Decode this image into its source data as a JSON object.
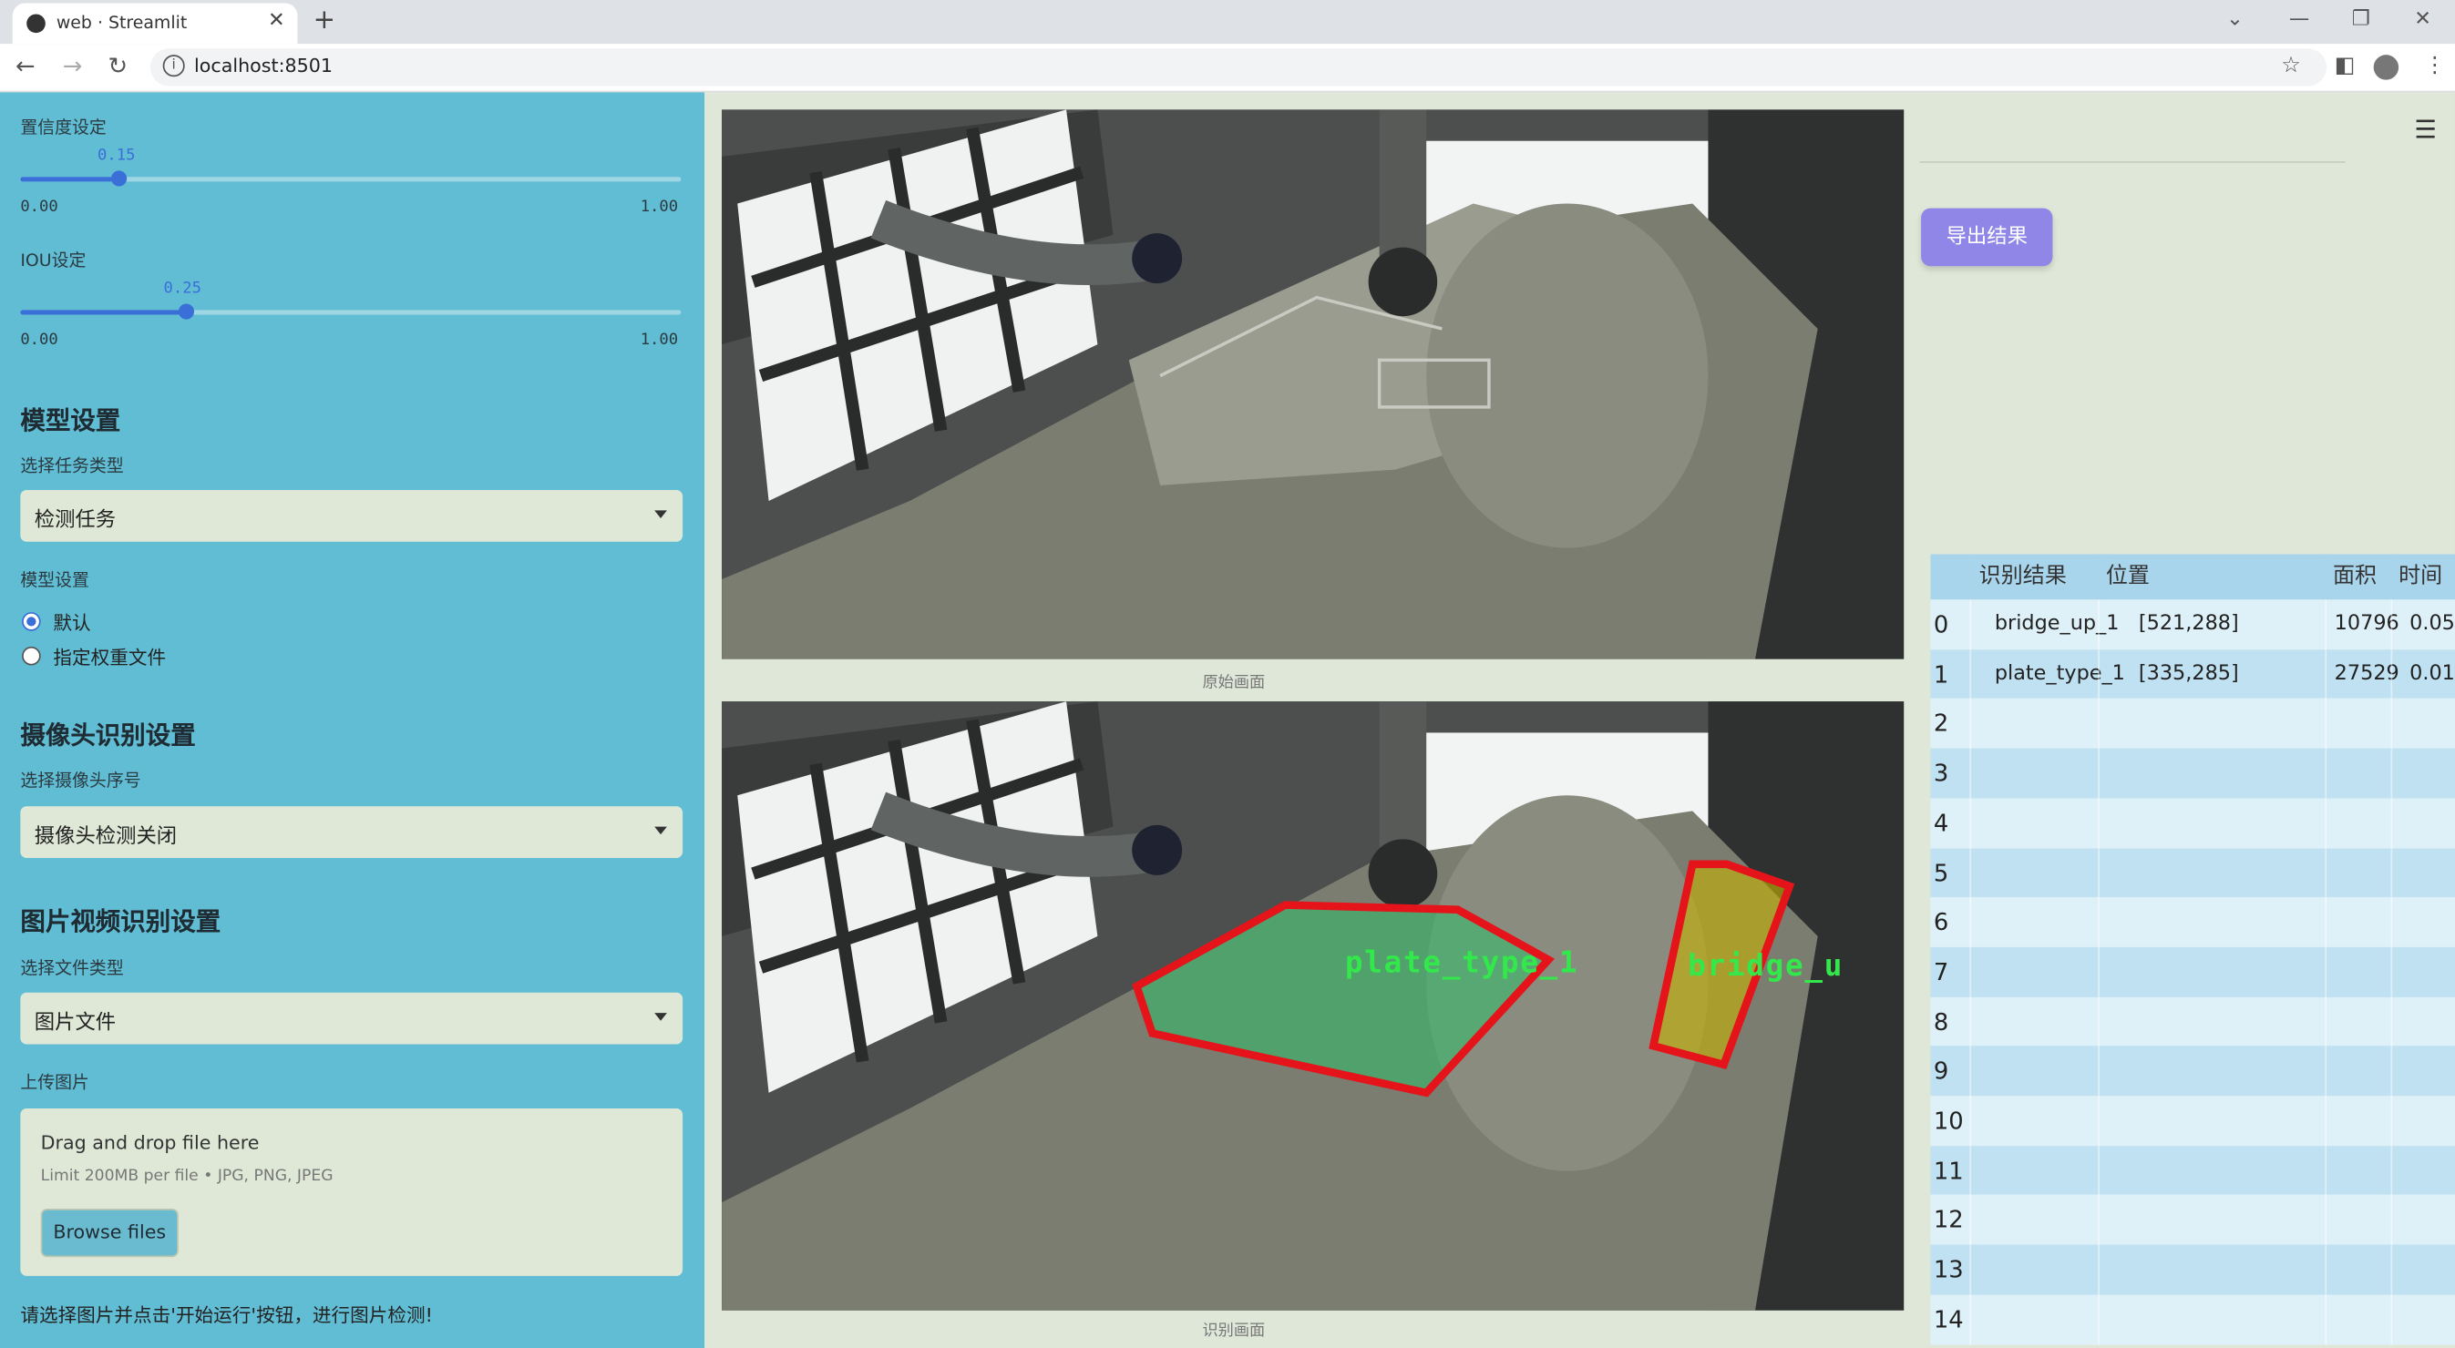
{
  "browser": {
    "tab_title": "web · Streamlit",
    "url": "localhost:8501"
  },
  "sidebar": {
    "confidence": {
      "label": "置信度设定",
      "value": 0.15,
      "value_text": "0.15",
      "min": "0.00",
      "max": "1.00"
    },
    "iou": {
      "label": "IOU设定",
      "value": 0.25,
      "value_text": "0.25",
      "min": "0.00",
      "max": "1.00"
    },
    "model_section": "模型设置",
    "task_type_label": "选择任务类型",
    "task_type_value": "检测任务",
    "model_setting_label": "模型设置",
    "model_options": [
      "默认",
      "指定权重文件"
    ],
    "model_selected": 0,
    "camera_section": "摄像头识别设置",
    "camera_label": "选择摄像头序号",
    "camera_value": "摄像头检测关闭",
    "media_section": "图片视频识别设置",
    "file_type_label": "选择文件类型",
    "file_type_value": "图片文件",
    "upload_label": "上传图片",
    "upload_title": "Drag and drop file here",
    "upload_limit": "Limit 200MB per file • JPG, PNG, JPEG",
    "browse_label": "Browse files",
    "footer": "请选择图片并点击'开始运行'按钮，进行图片检测!"
  },
  "main": {
    "caption_original": "原始画面",
    "caption_result": "识别画面",
    "export_label": "导出结果",
    "detections": [
      {
        "label": "plate_type_1",
        "color": "#2fbf6a"
      },
      {
        "label": "bridge_u",
        "color": "#c8b400"
      }
    ]
  },
  "table": {
    "headers": [
      "",
      "识别结果",
      "位置",
      "面积",
      "时间"
    ],
    "rows": [
      {
        "index": "0",
        "result": "bridge_up_1",
        "position": "[521,288]",
        "area": "10796",
        "time": "0.05"
      },
      {
        "index": "1",
        "result": "plate_type_1",
        "position": "[335,285]",
        "area": "27529",
        "time": "0.01"
      },
      {
        "index": "2"
      },
      {
        "index": "3"
      },
      {
        "index": "4"
      },
      {
        "index": "5"
      },
      {
        "index": "6"
      },
      {
        "index": "7"
      },
      {
        "index": "8"
      },
      {
        "index": "9"
      },
      {
        "index": "10"
      },
      {
        "index": "11"
      },
      {
        "index": "12"
      },
      {
        "index": "13"
      },
      {
        "index": "14"
      }
    ]
  },
  "colors": {
    "sidebar_bg": "#60bdd4",
    "accent": "#3a6fd8",
    "export_button": "#8f86e8",
    "box_outline": "#e4141a"
  }
}
